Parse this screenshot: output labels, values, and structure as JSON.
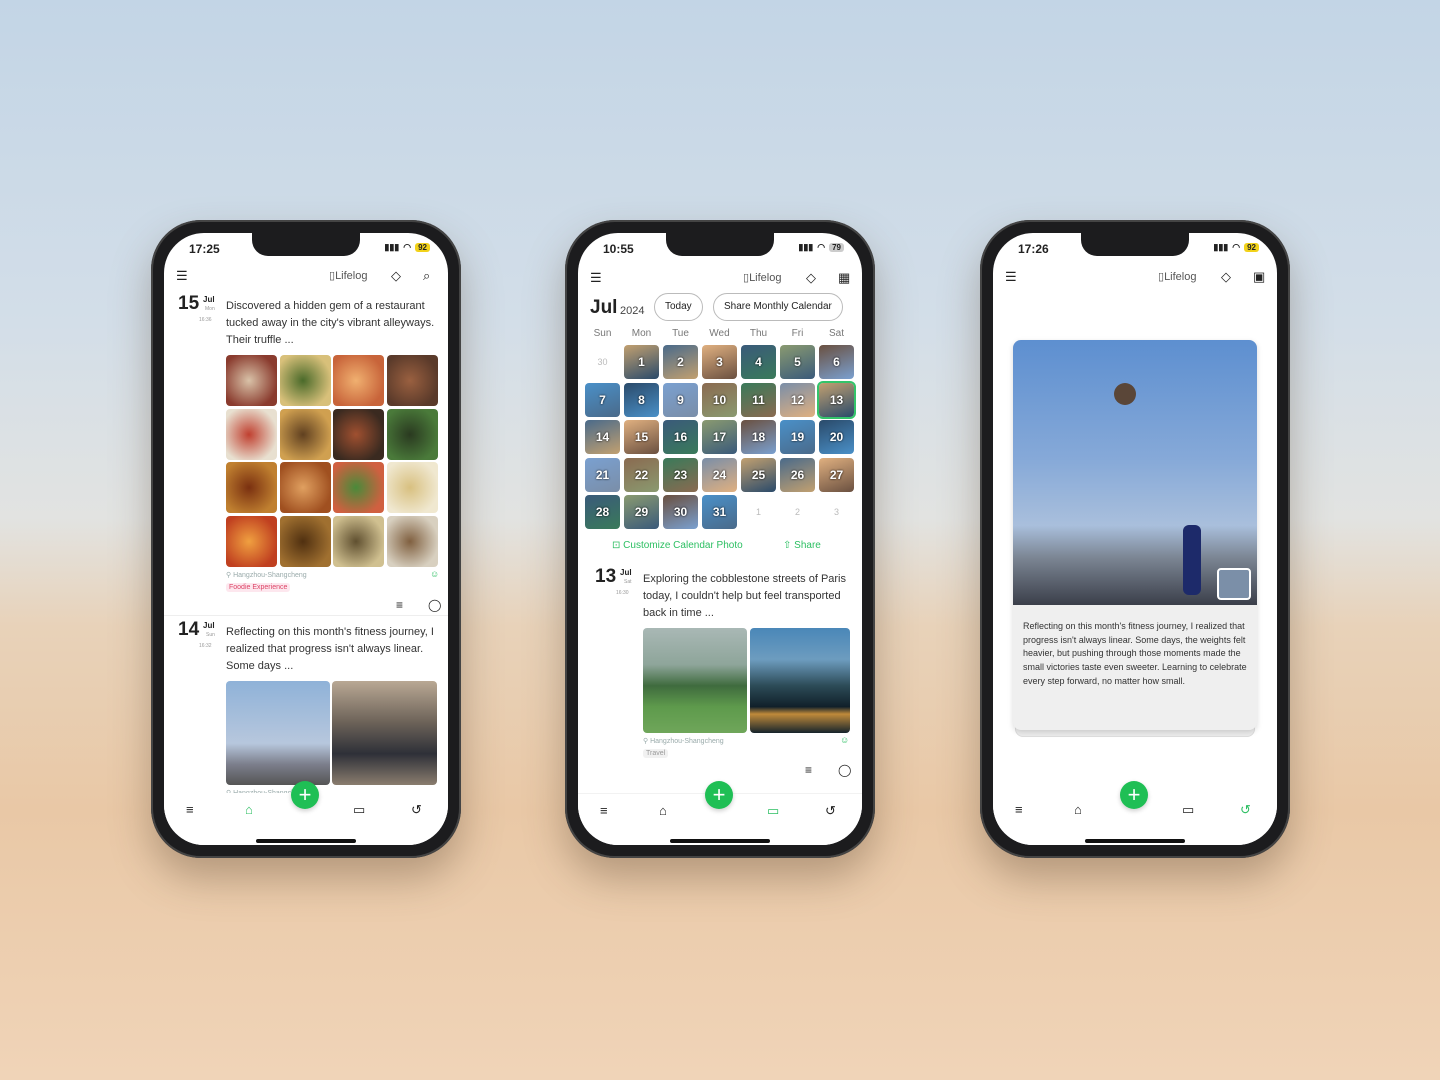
{
  "colors": {
    "accent": "#1fbf55",
    "badge_battery": "#f2d21a"
  },
  "app_title": "Lifelog",
  "phone1": {
    "time": "17:25",
    "battery": "92",
    "entries": [
      {
        "day": "15",
        "month": "Jul",
        "weekday": "Mon",
        "time": "16:36",
        "text": "Discovered a hidden gem of a restaurant tucked away in the city's vibrant alleyways. Their truffle  ...",
        "location": "Hangzhou-Shangcheng",
        "tag": "Foodie Experience",
        "photos": 16
      },
      {
        "day": "14",
        "month": "Jul",
        "weekday": "Sun",
        "time": "16:32",
        "text": "Reflecting on this month's fitness journey, I realized that progress isn't always linear. Some days ...",
        "location": "Hangzhou-Shangcheng",
        "photos": 2
      }
    ]
  },
  "phone2": {
    "time": "10:55",
    "battery": "79",
    "month": "Jul",
    "year": "2024",
    "today_label": "Today",
    "share_calendar_label": "Share Monthly Calendar",
    "weekdays": [
      "Sun",
      "Mon",
      "Tue",
      "Wed",
      "Thu",
      "Fri",
      "Sat"
    ],
    "calendar": [
      {
        "d": "30",
        "photo": false
      },
      {
        "d": "1",
        "photo": true
      },
      {
        "d": "2",
        "photo": true
      },
      {
        "d": "3",
        "photo": true
      },
      {
        "d": "4",
        "photo": true
      },
      {
        "d": "5",
        "photo": true
      },
      {
        "d": "6",
        "photo": true
      },
      {
        "d": "7",
        "photo": true
      },
      {
        "d": "8",
        "photo": true
      },
      {
        "d": "9",
        "photo": true
      },
      {
        "d": "10",
        "photo": true
      },
      {
        "d": "11",
        "photo": true
      },
      {
        "d": "12",
        "photo": true
      },
      {
        "d": "13",
        "photo": true,
        "selected": true
      },
      {
        "d": "14",
        "photo": true
      },
      {
        "d": "15",
        "photo": true
      },
      {
        "d": "16",
        "photo": true
      },
      {
        "d": "17",
        "photo": true
      },
      {
        "d": "18",
        "photo": true
      },
      {
        "d": "19",
        "photo": true
      },
      {
        "d": "20",
        "photo": true
      },
      {
        "d": "21",
        "photo": true
      },
      {
        "d": "22",
        "photo": true
      },
      {
        "d": "23",
        "photo": true
      },
      {
        "d": "24",
        "photo": true
      },
      {
        "d": "25",
        "photo": true
      },
      {
        "d": "26",
        "photo": true
      },
      {
        "d": "27",
        "photo": true
      },
      {
        "d": "28",
        "photo": true
      },
      {
        "d": "29",
        "photo": true
      },
      {
        "d": "30",
        "photo": true
      },
      {
        "d": "31",
        "photo": true
      },
      {
        "d": "1",
        "photo": false
      },
      {
        "d": "2",
        "photo": false
      },
      {
        "d": "3",
        "photo": false
      }
    ],
    "customize_label": "Customize Calendar Photo",
    "share_label": "Share",
    "entry": {
      "day": "13",
      "month": "Jul",
      "weekday": "Sat",
      "time": "16:30",
      "text": "Exploring the cobblestone streets of Paris today, I couldn't help but feel transported back in time ...",
      "location": "Hangzhou-Shangcheng",
      "tag": "Travel"
    }
  },
  "phone3": {
    "time": "17:26",
    "battery": "92",
    "card_text": "Reflecting on this month's fitness journey, I realized that progress isn't always linear. Some days, the weights felt heavier, but pushing through those moments made the small victories taste even sweeter. Learning to celebrate every step forward, no matter how small."
  },
  "nav": {
    "active": {
      "phone1": "home",
      "phone2": "calendar",
      "phone3": "history"
    }
  }
}
